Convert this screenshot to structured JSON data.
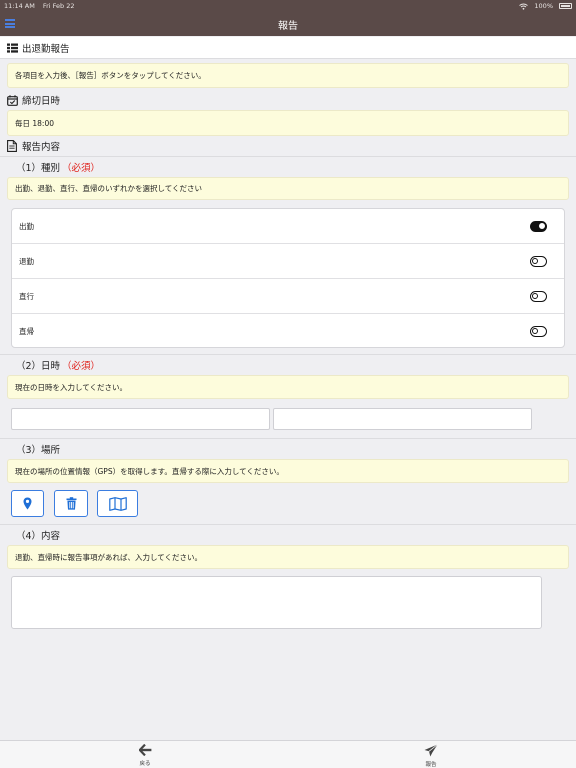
{
  "status_bar": {
    "time": "11:14 AM",
    "date": "Fri Feb 22",
    "battery": "100%"
  },
  "nav": {
    "title": "報告"
  },
  "header": {
    "title": "出退勤報告"
  },
  "intro_note": "各項目を入力後、［報告］ボタンをタップしてください。",
  "deadline": {
    "label": "締切日時",
    "value": "毎日 18:00"
  },
  "report_content": {
    "label": "報告内容"
  },
  "type_section": {
    "label": "（1）種別",
    "required": "（必須）",
    "note": "出勤、退勤、直行、直帰のいずれかを選択してください",
    "options": [
      {
        "label": "出勤",
        "selected": true
      },
      {
        "label": "退勤",
        "selected": false
      },
      {
        "label": "直行",
        "selected": false
      },
      {
        "label": "直帰",
        "selected": false
      }
    ]
  },
  "datetime_section": {
    "label": "（2）日時",
    "required": "（必須）",
    "note": "現在の日時を入力してください。",
    "date_value": "",
    "time_value": ""
  },
  "place_section": {
    "label": "（3）場所",
    "note": "現在の場所の位置情報（GPS）を取得します。直帰する際に入力してください。",
    "buttons": [
      "location-pin-icon",
      "trash-icon",
      "map-icon"
    ]
  },
  "content_section": {
    "label": "（4）内容",
    "note": "退勤、直帰時に報告事項があれば、入力してください。",
    "value": ""
  },
  "tabbar": {
    "back": "戻る",
    "report": "報告"
  },
  "colors": {
    "nav_bg": "#5a4a48",
    "note_bg": "#fdfcdc",
    "accent": "#3b7de0",
    "required": "#e0201a"
  }
}
